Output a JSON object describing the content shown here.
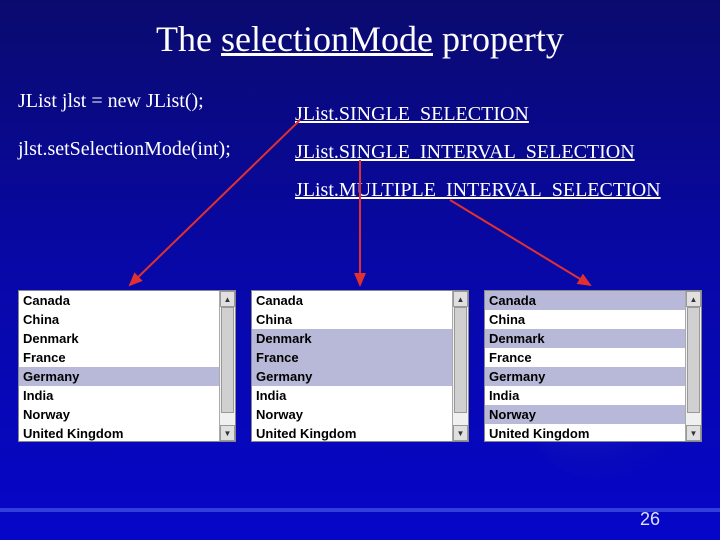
{
  "title_pre": "The ",
  "title_underlined": "selectionMode",
  "title_post": " property",
  "code_line1": "JList jlst = new JList();",
  "code_line2": "jlst.setSelectionMode(int);",
  "mode1": "JList.SINGLE_SELECTION",
  "mode2": "JList.SINGLE_INTERVAL_SELECTION",
  "mode3": "JList.MULTIPLE_INTERVAL_SELECTION",
  "list_items": [
    "Canada",
    "China",
    "Denmark",
    "France",
    "Germany",
    "India",
    "Norway",
    "United Kingdom"
  ],
  "selections": {
    "single": [
      4
    ],
    "interval": [
      2,
      3,
      4
    ],
    "multi": [
      0,
      2,
      4,
      6
    ]
  },
  "page_number": "26",
  "arrow_up": "▲",
  "arrow_down": "▼"
}
